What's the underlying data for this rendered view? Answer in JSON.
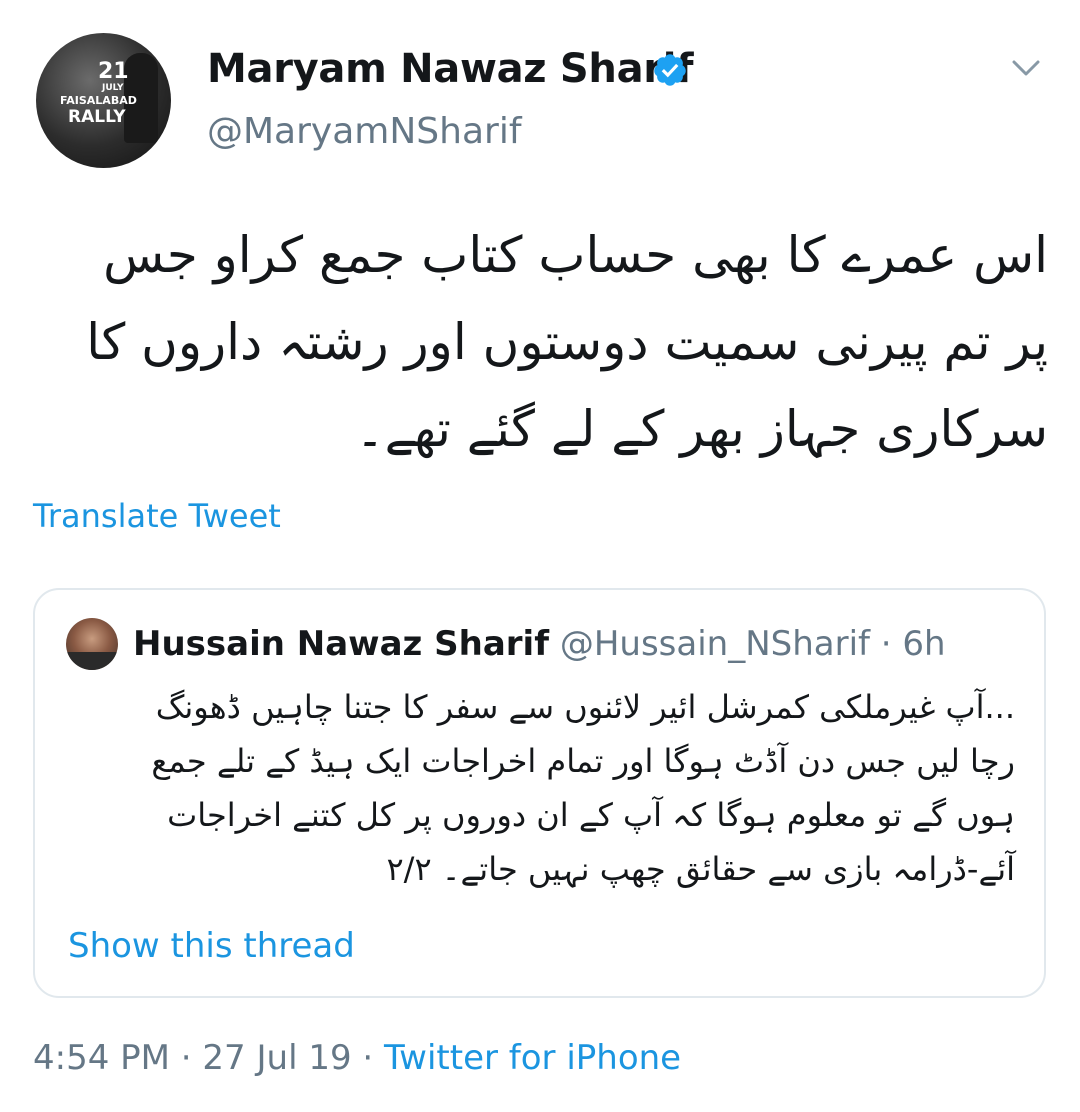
{
  "author": {
    "display_name": "Maryam Nawaz Sharif",
    "handle": "@MaryamNSharif",
    "verified": true,
    "avatar_text": [
      "21",
      "JULY",
      "FAISALABAD",
      "RALLY"
    ]
  },
  "tweet": {
    "text": "اس عمرے کا بھی حساب کتاب جمع کراو جس\nپر تم پیرنی سمیت دوستوں اور رشتہ داروں کا\nسرکاری جہاز بھر کے لے گئے تھے۔",
    "translate_label": "Translate Tweet"
  },
  "quoted_tweet": {
    "display_name": "Hussain Nawaz Sharif",
    "handle_time": "@Hussain_NSharif · 6h",
    "text": "...آپ غیرملکی کمرشل ائیر لائنوں سے سفر کا جتنا چاہیں ڈھونگ\nرچا لیں جس دن آڈٹ ہوگا اور تمام  اخراجات ایک ہیڈ کے تلے جمع\nہوں گے تو معلوم ہوگا کہ آپ کے ان دوروں پر کل کتنے اخراجات\nآئے-ڈرامہ بازی سے حقائق چھپ نہیں جاتے۔  ۲/۲",
    "show_thread_label": "Show this thread"
  },
  "footer": {
    "time_date": "4:54 PM · 27 Jul 19 · ",
    "source": "Twitter for iPhone"
  },
  "icons": {
    "verified": "verified-badge-icon",
    "chevron": "chevron-down-icon"
  },
  "colors": {
    "link": "#1b95e0",
    "secondary_text": "#657786",
    "border": "#e1e8ed"
  }
}
